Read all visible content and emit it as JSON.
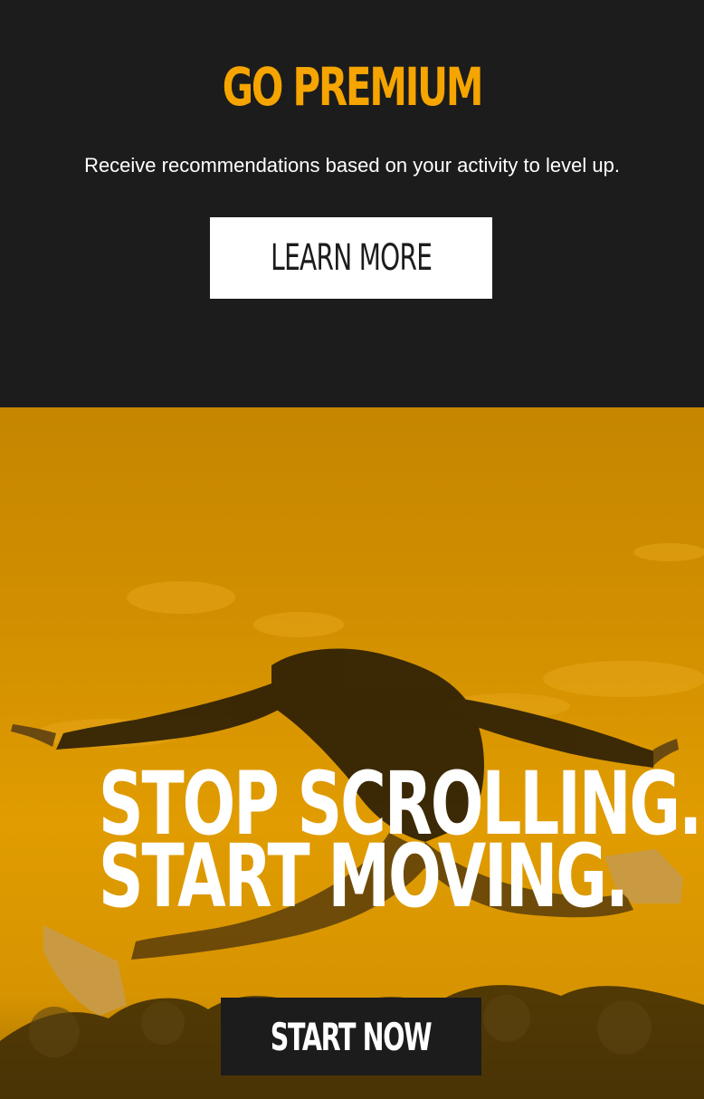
{
  "premium": {
    "title": "GO PREMIUM",
    "description": "Receive recommendations based on your activity to level up.",
    "button_label": "LEARN MORE"
  },
  "hero": {
    "headline_line1": "STOP SCROLLING.",
    "headline_line2": "START MOVING.",
    "button_label": "START NOW"
  },
  "colors": {
    "accent": "#f5a400",
    "dark": "#1c1c1c",
    "hero_tint": "#d49200",
    "white": "#ffffff"
  }
}
